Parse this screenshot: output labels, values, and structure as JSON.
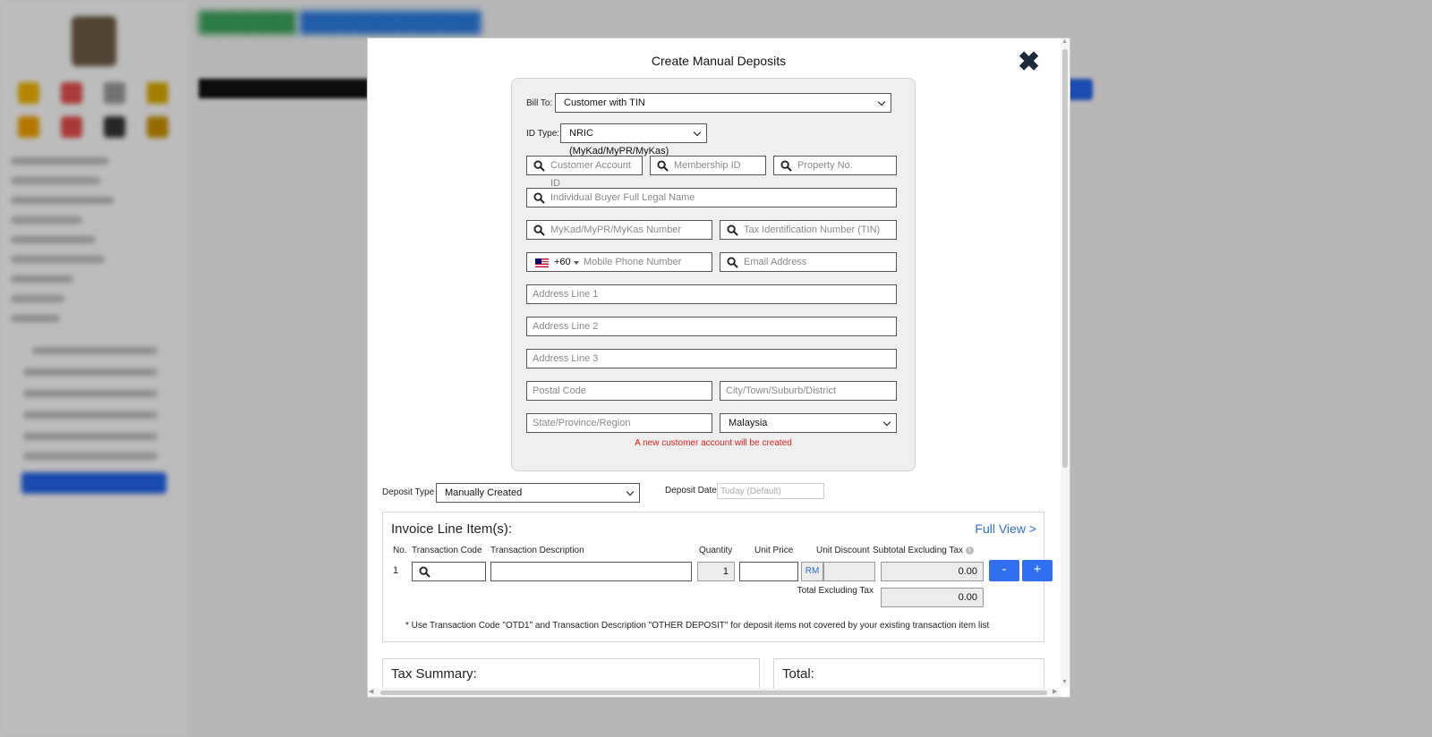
{
  "modal": {
    "title": "Create Manual Deposits",
    "close_symbol": "✖"
  },
  "customer": {
    "bill_to_label": "Bill To:",
    "bill_to_value": "Customer with TIN",
    "id_type_label": "ID Type:",
    "id_type_value": "NRIC (MyKad/MyPR/MyKas)",
    "customer_account_placeholder": "Customer Account ID",
    "membership_placeholder": "Membership ID",
    "property_placeholder": "Property No.",
    "full_name_placeholder": "Individual Buyer Full Legal Name",
    "id_number_placeholder": "MyKad/MyPR/MyKas Number",
    "tin_placeholder": "Tax Identification Number (TIN)",
    "country_code": "+60",
    "mobile_placeholder": "Mobile Phone Number",
    "email_placeholder": "Email Address",
    "address1_placeholder": "Address Line 1",
    "address2_placeholder": "Address Line 2",
    "address3_placeholder": "Address Line 3",
    "postal_placeholder": "Postal Code",
    "city_placeholder": "City/Town/Suburb/District",
    "state_placeholder": "State/Province/Region",
    "country_value": "Malaysia",
    "notice": "A new customer account will be created"
  },
  "deposit": {
    "type_label": "Deposit Type",
    "type_value": "Manually Created",
    "date_label": "Deposit Date",
    "date_placeholder": "Today (Default)"
  },
  "invoice": {
    "title": "Invoice Line Item(s):",
    "full_view": "Full View >",
    "headers": {
      "no": "No.",
      "code": "Transaction Code",
      "desc": "Transaction Description",
      "qty": "Quantity",
      "price": "Unit Price",
      "discount": "Unit Discount",
      "subtotal": "Subtotal Excluding Tax"
    },
    "info_symbol": "i",
    "row": {
      "no": "1",
      "quantity": "1",
      "currency": "RM",
      "subtotal": "0.00"
    },
    "minus_label": "-",
    "plus_label": "+",
    "total_label": "Total Excluding Tax",
    "total_value": "0.00",
    "note": "* Use Transaction Code \"OTD1\" and Transaction Description \"OTHER DEPOSIT\" for deposit items not covered by your existing transaction item list"
  },
  "summary": {
    "tax_title": "Tax Summary:",
    "total_title": "Total:"
  },
  "colors": {
    "accent": "#2f6ff0",
    "notice": "#d92020",
    "link": "#2b6fd6"
  }
}
